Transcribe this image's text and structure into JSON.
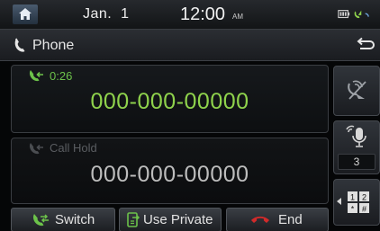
{
  "status_bar": {
    "date": "Jan.  1",
    "time": "12:00",
    "ampm": "AM",
    "icons": [
      "home-icon",
      "battery-icon",
      "phone-signal-icon"
    ]
  },
  "title_bar": {
    "title": "Phone",
    "icons": [
      "phone-icon",
      "back-icon"
    ]
  },
  "active_call": {
    "duration": "0:26",
    "number": "000-000-00000",
    "color": "#8fd34c"
  },
  "held_call": {
    "status": "Call Hold",
    "number": "000-000-00000"
  },
  "side_buttons": {
    "mute_icon": "mute-speaker-icon",
    "mic_icon": "microphone-icon",
    "volume": "3",
    "keypad_keys": [
      "1",
      "2",
      "*",
      "#"
    ]
  },
  "bottom_buttons": {
    "switch": "Switch",
    "use_private": "Use Private",
    "end": "End",
    "end_color": "#d22a2a"
  }
}
